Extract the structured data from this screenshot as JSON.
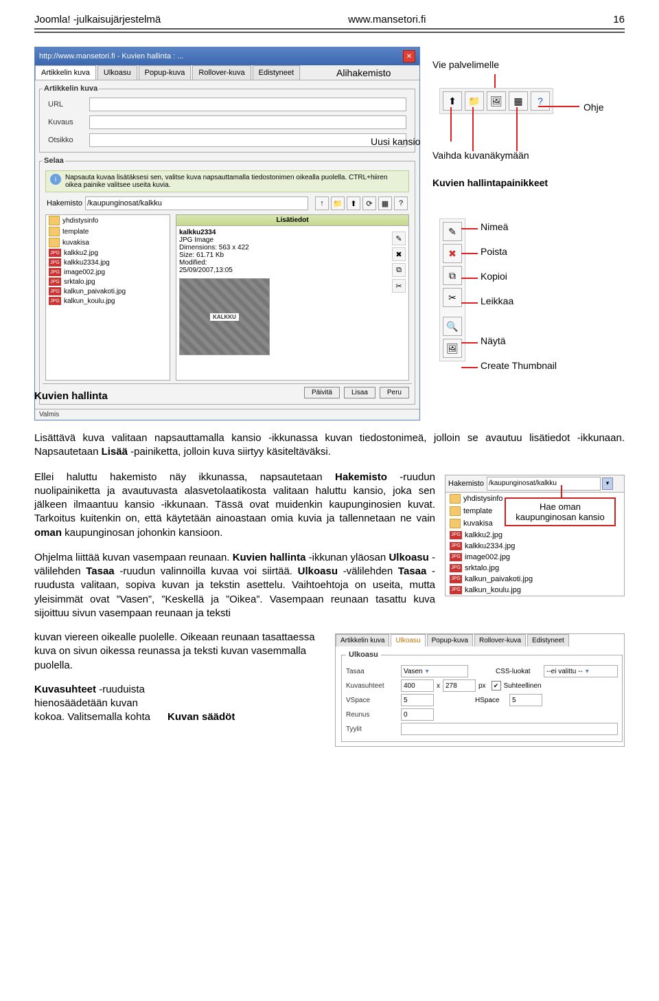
{
  "header": {
    "left": "Joomla! -julkaisujärjestelmä",
    "center": "www.mansetori.fi",
    "right": "16"
  },
  "dialog": {
    "titlebar": "http://www.mansetori.fi - Kuvien hallinta : ...",
    "tabs": [
      "Artikkelin kuva",
      "Ulkoasu",
      "Popup-kuva",
      "Rollover-kuva",
      "Edistyneet"
    ],
    "fieldset_label": "Artikkelin kuva",
    "fields": {
      "url": "URL",
      "kuvaus": "Kuvaus",
      "otsikko": "Otsikko"
    },
    "selaa_legend": "Selaa",
    "hint_text": "Napsauta kuvaa lisätäksesi sen, valitse kuva napsauttamalla tiedostonimen oikealla puolella. CTRL+hiiren oikea painike valitsee useita kuvia.",
    "path_label": "Hakemisto",
    "path_value": "/kaupunginosat/kalkku",
    "files": [
      {
        "type": "folder",
        "name": "yhdistysinfo"
      },
      {
        "type": "folder",
        "name": "template"
      },
      {
        "type": "folder",
        "name": "kuvakisa"
      },
      {
        "type": "jpg",
        "name": "kalkku2.jpg"
      },
      {
        "type": "jpg",
        "name": "kalkku2334.jpg"
      },
      {
        "type": "jpg",
        "name": "image002.jpg"
      },
      {
        "type": "jpg",
        "name": "srktalo.jpg"
      },
      {
        "type": "jpg",
        "name": "kalkun_paivakoti.jpg"
      },
      {
        "type": "jpg",
        "name": "kalkun_koulu.jpg"
      }
    ],
    "detail_header": "Lisätiedot",
    "detail": {
      "name": "kalkku2334",
      "type": "JPG Image",
      "dim": "Dimensions: 563 x 422",
      "size": "Size: 61.71 Kb",
      "mod": "Modified:",
      "date": "25/09/2007,13:05",
      "thumb_badge": "KALKKU"
    },
    "buttons": {
      "paivita": "Päivitä",
      "lisaa": "Lisaa",
      "peru": "Peru"
    },
    "status": "Valmis"
  },
  "callouts": {
    "kuvien_hallinta": "Kuvien hallinta",
    "alihakemisto": "Alihakemisto",
    "vie": "Vie palvelimelle",
    "ohje": "Ohje",
    "uusi_kansio": "Uusi kansio",
    "vaihda": "Vaihda kuvanäkymään",
    "kuvien_hp": "Kuvien hallintapainikkeet",
    "nimea": "Nimeä",
    "poista": "Poista",
    "kopioi": "Kopioi",
    "leikkaa": "Leikkaa",
    "nayta": "Näytä",
    "create_thumb": "Create Thumbnail"
  },
  "para1": "Lisättävä kuva valitaan napsauttamalla kansio -ikkunassa kuvan tiedostonimeä, jolloin se avautuu lisätiedot -ikkunaan. Napsautetaan Lisää -painiketta, jolloin kuva siirtyy käsiteltäväksi.",
  "para2": "Ellei haluttu hakemisto näy ikkunassa, napsautetaan Hakemisto -ruudun nuolipainiketta ja avautuvasta alasvetolaatikosta valitaan haluttu kansio, joka sen jälkeen ilmaantuu kansio -ikkunaan. Tässä ovat muidenkin kaupunginosien kuvat. Tarkoitus kuitenkin on, että käytetään ainoastaan omia kuvia ja tallennetaan ne vain oman kaupunginosan johonkin kansioon.",
  "hak": {
    "label": "Hakemisto",
    "path": "/kaupunginosat/kalkku",
    "annot": "Hae oman kaupunginosan kansio",
    "items": [
      {
        "type": "folder",
        "name": "yhdistysinfo"
      },
      {
        "type": "folder",
        "name": "template"
      },
      {
        "type": "folder",
        "name": "kuvakisa"
      },
      {
        "type": "jpg",
        "name": "kalkku2.jpg"
      },
      {
        "type": "jpg",
        "name": "kalkku2334.jpg"
      },
      {
        "type": "jpg",
        "name": "image002.jpg"
      },
      {
        "type": "jpg",
        "name": "srktalo.jpg"
      },
      {
        "type": "jpg",
        "name": "kalkun_paivakoti.jpg"
      },
      {
        "type": "jpg",
        "name": "kalkun_koulu.jpg"
      }
    ]
  },
  "para3": "Ohjelma liittää kuvan vasempaan reunaan. Kuvien hallinta -ikkunan yläosan Ulkoasu -välilehden Tasaa -ruudun valinnoilla kuvaa voi siirtää. Ulkoasu -välilehden Tasaa -ruudusta valitaan, sopiva kuvan ja tekstin asettelu. Vaihtoehtoja on useita, mutta yleisimmät ovat ”Vasen”, ”Keskellä ja ”Oikea”. Vasempaan reunaan tasattu kuva sijoittuu sivun vasempaan reunaan ja teksti kuvan viereen oikealle puolelle. Oikeaan reunaan tasattaessa kuva on sivun oikessa reunassa ja teksti kuvan vasemmalla puolella.",
  "ulk": {
    "tabs": [
      "Artikkelin kuva",
      "Ulkoasu",
      "Popup-kuva",
      "Rollover-kuva",
      "Edistyneet"
    ],
    "legend": "Ulkoasu",
    "tasaa_l": "Tasaa",
    "tasaa_v": "Vasen",
    "css_l": "CSS-luokat",
    "css_v": "--ei valittu --",
    "ks_l": "Kuvasuhteet",
    "ks_w": "400",
    "ks_x": "x",
    "ks_h": "278",
    "ks_u": "px",
    "ks_chk": "Suhteellinen",
    "vs_l": "VSpace",
    "vs_v": "5",
    "hs_l": "HSpace",
    "hs_v": "5",
    "re_l": "Reunus",
    "re_v": "0",
    "ty_l": "Tyylit"
  },
  "para4_a": "Kuvasuhteet -ruuduista hienosäädetään kuvan kokoa. Valitsemalla kohta",
  "caption": "Kuvan säädöt"
}
